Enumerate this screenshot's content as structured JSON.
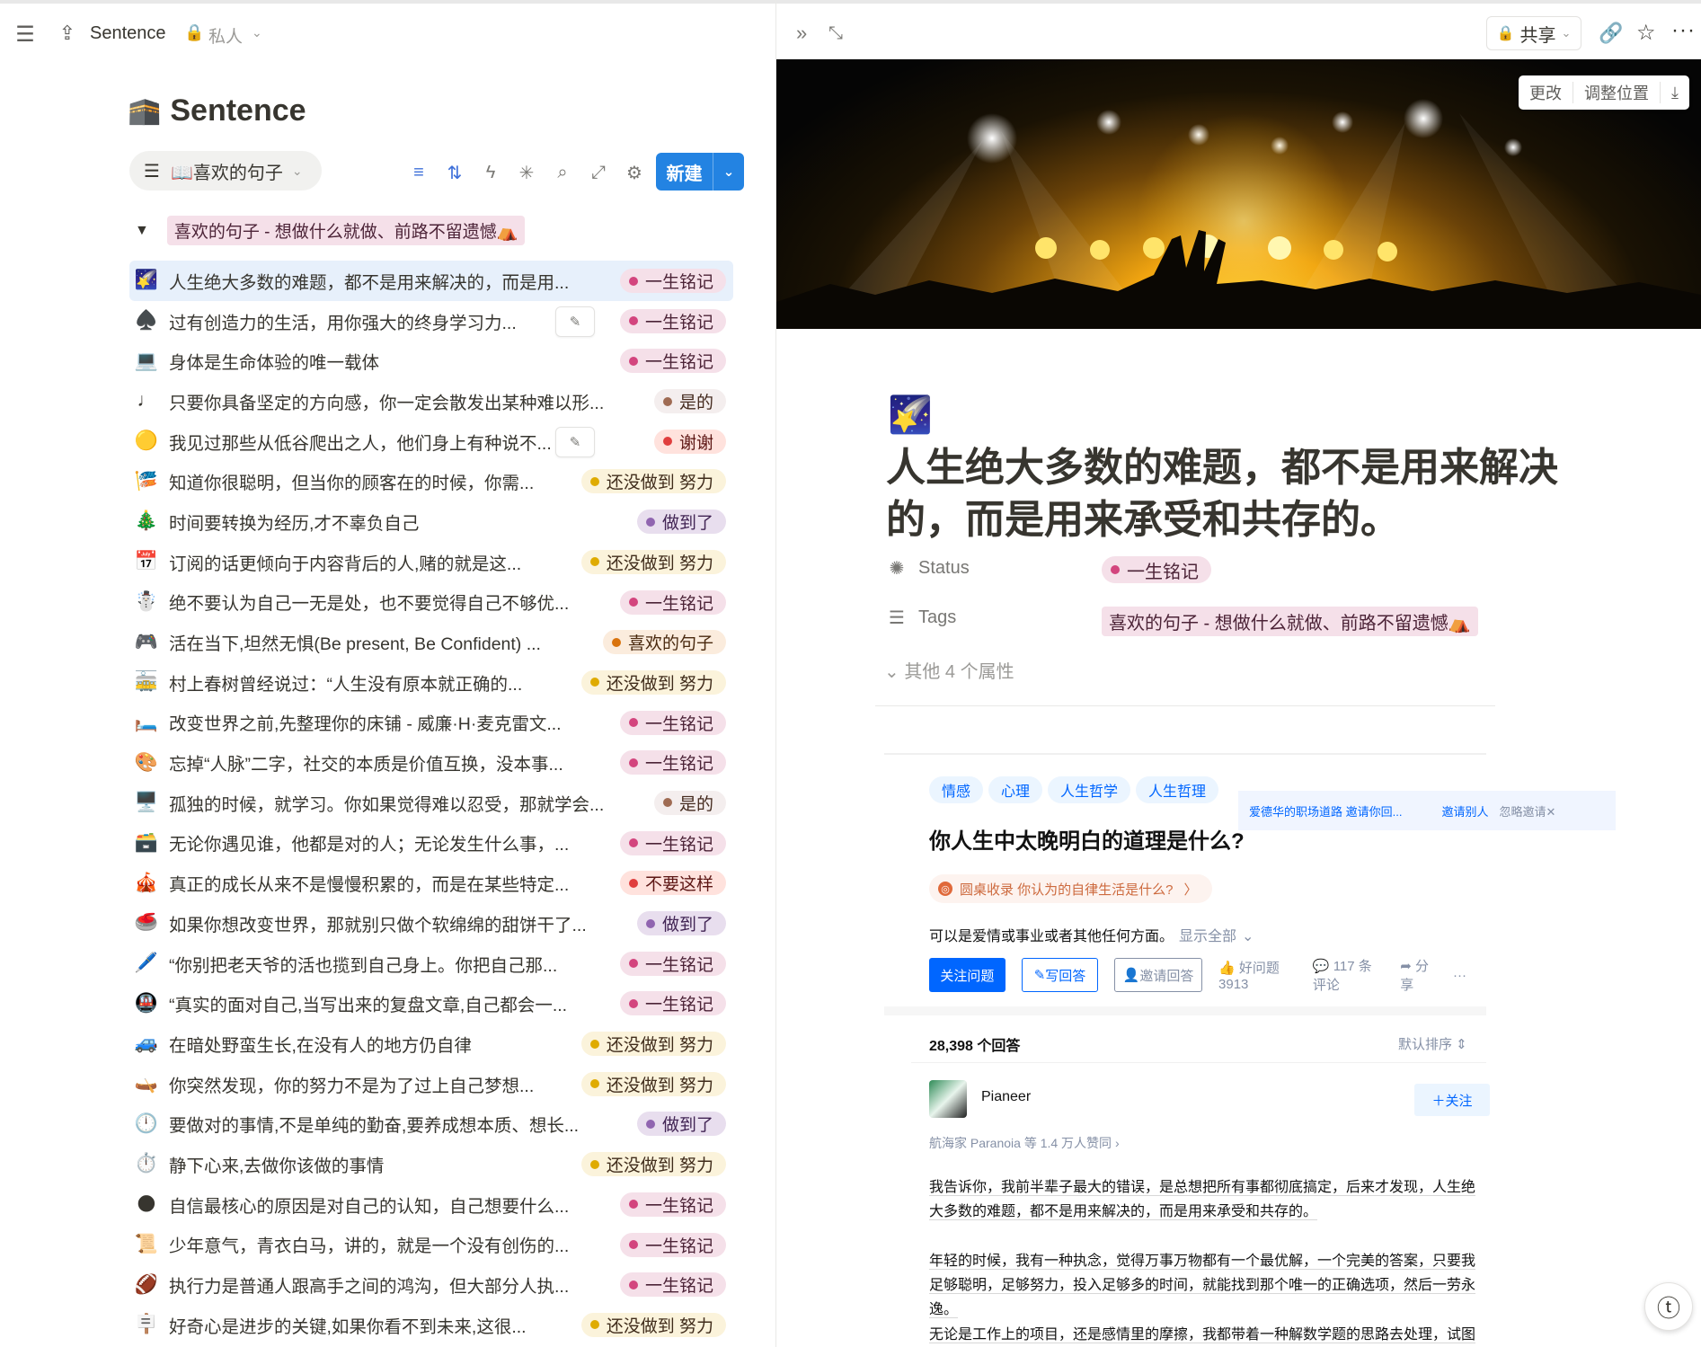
{
  "left": {
    "breadcrumb_title": "Sentence",
    "breadcrumb_privacy": "私人",
    "db_icon": "🕋",
    "db_title": "Sentence",
    "view_tab": "📖喜欢的句子",
    "new_button": "新建",
    "group_label": "喜欢的句子 - 想做什么就做、前路不留遗憾⛺",
    "rows": [
      {
        "emoji": "🌠",
        "text": "人生绝大多数的难题，都不是用来解决的，而是用...",
        "badge": "一生铭记",
        "color": "pink",
        "selected": true
      },
      {
        "emoji": "♠️",
        "text": "过有创造力的生活，用你强大的终身学习力...",
        "badge": "一生铭记",
        "color": "pink",
        "edit": true
      },
      {
        "emoji": "💻",
        "text": "身体是生命体验的唯一载体",
        "badge": "一生铭记",
        "color": "pink"
      },
      {
        "emoji": "♩",
        "text": "只要你具备坚定的方向感，你一定会散发出某种难以形...",
        "badge": "是的",
        "color": "brown"
      },
      {
        "emoji": "🟡",
        "text": "我见过那些从低谷爬出之人，他们身上有种说不...",
        "badge": "谢谢",
        "color": "red",
        "edit": true
      },
      {
        "emoji": "🎏",
        "text": "知道你很聪明，但当你的顾客在的时候，你需...",
        "badge": "还没做到 努力",
        "color": "yellow"
      },
      {
        "emoji": "🎄",
        "text": "时间要转换为经历,才不辜负自己",
        "badge": "做到了",
        "color": "purple"
      },
      {
        "emoji": "📅",
        "text": "订阅的话更倾向于内容背后的人,赌的就是这...",
        "badge": "还没做到 努力",
        "color": "yellow"
      },
      {
        "emoji": "☃️",
        "text": "绝不要认为自己一无是处，也不要觉得自己不够优...",
        "badge": "一生铭记",
        "color": "pink"
      },
      {
        "emoji": "🎮",
        "text": "活在当下,坦然无惧(Be present, Be Confident) ...",
        "badge": "喜欢的句子",
        "color": "orange"
      },
      {
        "emoji": "🚋",
        "text": "村上春树曾经说过：“人生没有原本就正确的...",
        "badge": "还没做到 努力",
        "color": "yellow"
      },
      {
        "emoji": "🛏️",
        "text": "改变世界之前,先整理你的床铺 - 威廉·H·麦克雷文...",
        "badge": "一生铭记",
        "color": "pink"
      },
      {
        "emoji": "🎨",
        "text": "忘掉“人脉”二字，社交的本质是价值互换，没本事...",
        "badge": "一生铭记",
        "color": "pink"
      },
      {
        "emoji": "🖥️",
        "text": "孤独的时候，就学习。你如果觉得难以忍受，那就学会...",
        "badge": "是的",
        "color": "brown"
      },
      {
        "emoji": "🗃️",
        "text": "无论你遇见谁，他都是对的人；无论发生什么事，...",
        "badge": "一生铭记",
        "color": "pink"
      },
      {
        "emoji": "🎪",
        "text": "真正的成长从来不是慢慢积累的，而是在某些特定...",
        "badge": "不要这样",
        "color": "red"
      },
      {
        "emoji": "🥌",
        "text": "如果你想改变世界，那就别只做个软绵绵的甜饼干了...",
        "badge": "做到了",
        "color": "purple"
      },
      {
        "emoji": "🖊️",
        "text": "“你别把老天爷的活也揽到自己身上。你把自己那...",
        "badge": "一生铭记",
        "color": "pink"
      },
      {
        "emoji": "🚇",
        "text": "“真实的面对自己,当写出来的复盘文章,自己都会一...",
        "badge": "一生铭记",
        "color": "pink"
      },
      {
        "emoji": "🚙",
        "text": "在暗处野蛮生长,在没有人的地方仍自律",
        "badge": "还没做到 努力",
        "color": "yellow"
      },
      {
        "emoji": "🛶",
        "text": "你突然发现，你的努力不是为了过上自己梦想...",
        "badge": "还没做到 努力",
        "color": "yellow"
      },
      {
        "emoji": "🕛",
        "text": "要做对的事情,不是单纯的勤奋,要养成想本质、想长...",
        "badge": "做到了",
        "color": "purple"
      },
      {
        "emoji": "⏱️",
        "text": "静下心来,去做你该做的事情",
        "badge": "还没做到 努力",
        "color": "yellow"
      },
      {
        "emoji": "🌑",
        "text": "自信最核心的原因是对自己的认知，自己想要什么...",
        "badge": "一生铭记",
        "color": "pink"
      },
      {
        "emoji": "📜",
        "text": "少年意气，青衣白马，讲的，就是一个没有创伤的...",
        "badge": "一生铭记",
        "color": "pink"
      },
      {
        "emoji": "🏈",
        "text": "执行力是普通人跟高手之间的鸿沟，但大部分人执...",
        "badge": "一生铭记",
        "color": "pink"
      },
      {
        "emoji": "🪧",
        "text": "好奇心是进步的关键,如果你看不到未来,这很...",
        "badge": "还没做到 努力",
        "color": "yellow"
      }
    ]
  },
  "right": {
    "share_label": "共享",
    "cover_change": "更改",
    "cover_reposition": "调整位置",
    "page_emoji": "🌠",
    "page_title": "人生绝大多数的难题，都不是用来解决的，而是用来承受和共存的。",
    "status_label": "Status",
    "status_value": "一生铭记",
    "tags_label": "Tags",
    "tags_value": "喜欢的句子 - 想做什么就做、前路不留遗憾⛺",
    "more_props": "其他 4 个属性"
  },
  "zhihu": {
    "topics": [
      "情感",
      "心理",
      "人生哲学",
      "人生哲理"
    ],
    "invite_text": "爱德华的职场道路 邀请你回...",
    "invite_others": "邀请别人",
    "ignore_invite": "忽略邀请✕",
    "question": "你人生中太晚明白的道理是什么?",
    "roundtable": "圆桌收录 你认为的自律生活是什么?",
    "roundtable_arrow": "〉",
    "description": "可以是爱情或事业或者其他任何方面。",
    "show_all": "显示全部",
    "follow_question": "关注问题",
    "write_answer": "写回答",
    "invite_answer": "邀请回答",
    "good_question": "好问题 3913",
    "comments": "117 条评论",
    "share": "分享",
    "more": "···",
    "answer_count": "28,398 个回答",
    "sort": "默认排序",
    "author": "Pianeer",
    "follow_author": "关注",
    "author_meta": "航海家 Paranoia 等 1.4 万人赞同 ›",
    "p1": "我告诉你，我前半辈子最大的错误，是总想把所有事都彻底搞定，后来才发现，人生绝大多数的难题，都不是用来解决的，而是用来承受和共存的。",
    "p2": "年轻的时候，我有一种执念，觉得万事万物都有一个最优解，一个完美的答案，只要我足够聪明，足够努力，投入足够多的时间，就能找到那个唯一的正确选项，然后一劳永逸。",
    "p3": "无论是工作上的项目，还是感情里的摩擦，我都带着一种解数学题的思路去处理，试图分析所有变"
  },
  "colors": {
    "accent": "#2383e2",
    "pink_badge": "#f5e0e9",
    "yellow_badge": "#fbf3db",
    "purple_badge": "#e8deee",
    "red_badge": "#ffe2dd",
    "brown_badge": "#f4eeee",
    "orange_badge": "#fbecdd",
    "zhihu_blue": "#0066ff"
  },
  "icons": {
    "menu": "hamburger-icon",
    "share_up": "share-up-icon",
    "lock": "lock-icon",
    "filter": "filter-icon",
    "sort": "sort-icon",
    "automation": "lightning-icon",
    "ai": "sparkle-icon",
    "search": "search-icon",
    "expand": "expand-icon",
    "settings": "sliders-icon",
    "link": "link-icon",
    "star": "star-icon",
    "collapse": "double-chevron-right-icon"
  }
}
